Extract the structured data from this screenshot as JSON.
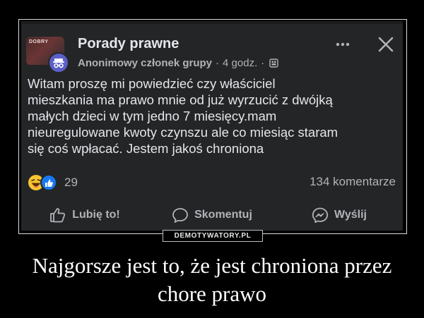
{
  "post": {
    "group_name": "Porady prawne",
    "author": "Anonimowy członek grupy",
    "separator": "·",
    "time": "4 godz.",
    "avatar_text": "DOBRY",
    "more_icon": "more-dots-icon",
    "close_icon": "close-icon",
    "text_lines": [
      "Witam proszę mi powiedzieć czy właściciel",
      "mieszkania ma prawo mnie od już wyrzucić z dwójką",
      "małych dzieci w tym jedno 7 miesięcy.mam",
      "nieuregulowane kwoty czynszu ale co miesiąc staram",
      "się coś wpłacać. Jestem jakoś chroniona"
    ],
    "reaction_count": "29",
    "comments": "134 komentarze"
  },
  "actions": {
    "like": "Lubię to!",
    "comment": "Skomentuj",
    "send": "Wyślij"
  },
  "watermark": "DEMOTYWATORY.PL",
  "caption_lines": [
    "Najgorsze jest to, że jest chroniona przez",
    "chore prawo"
  ],
  "colors": {
    "background": "#000000",
    "card": "#242526",
    "text": "#e4e6eb",
    "muted": "#b0b3b8",
    "like_blue": "#1877f2",
    "anon_purple": "#5b5fc7"
  }
}
